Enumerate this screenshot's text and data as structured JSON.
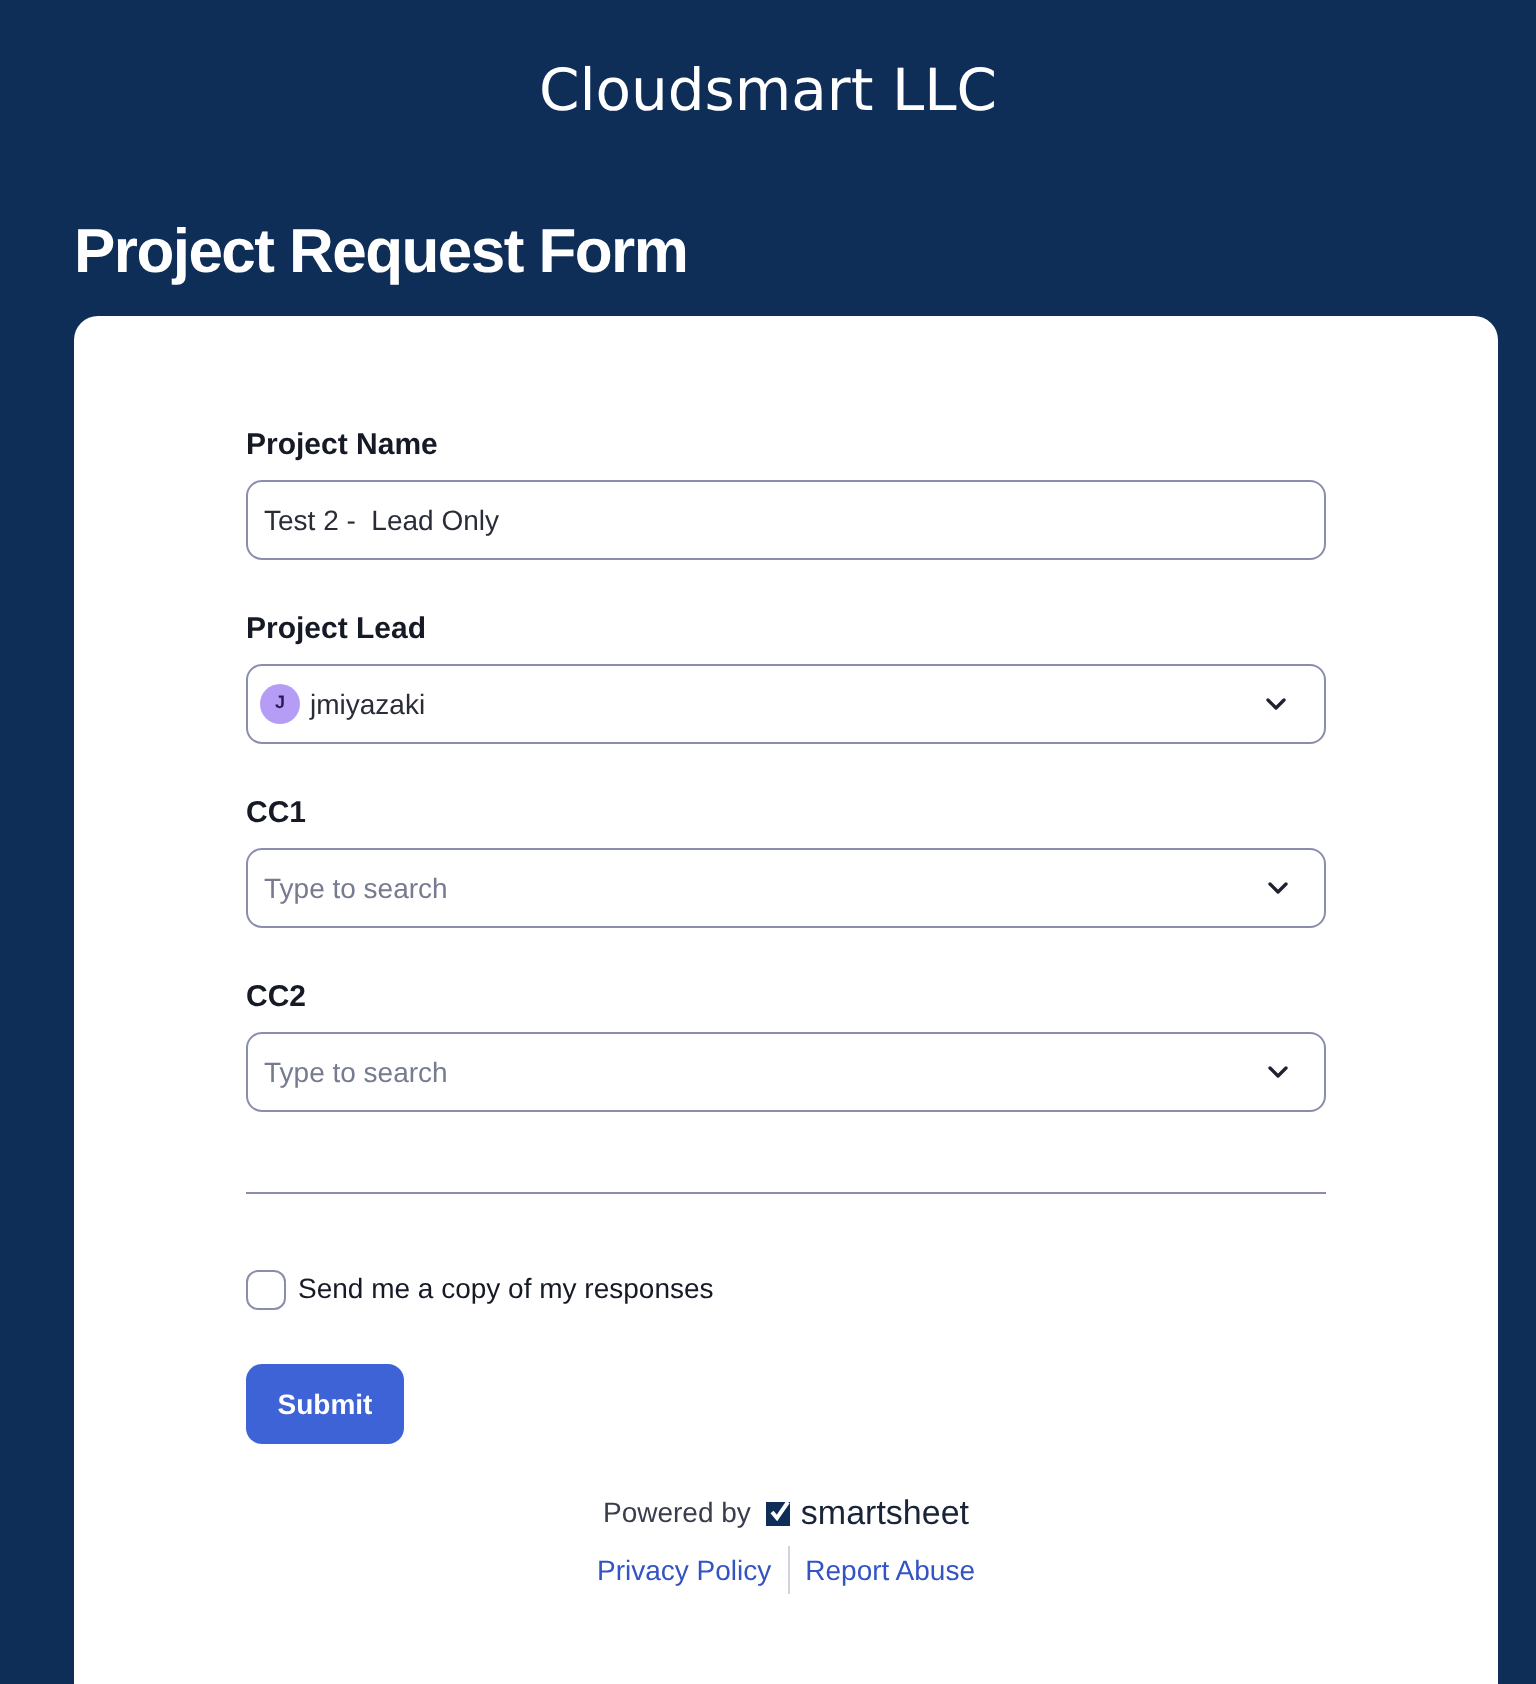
{
  "company": "Cloudsmart LLC",
  "title": "Project Request Form",
  "fields": [
    {
      "kind": "text",
      "label": "Project Name",
      "value": "Test 2 -  Lead Only"
    },
    {
      "kind": "person",
      "label": "Project Lead",
      "initial": "J",
      "value": "jmiyazaki"
    },
    {
      "kind": "select",
      "label": "CC1",
      "placeholder": "Type to search"
    },
    {
      "kind": "select",
      "label": "CC2",
      "placeholder": "Type to search"
    }
  ],
  "copy_option": {
    "label": "Send me a copy of my responses",
    "checked": false
  },
  "submit": "Submit",
  "footer": {
    "powered_by": "Powered by",
    "brand": "smartsheet",
    "links": [
      "Privacy Policy",
      "Report Abuse"
    ]
  }
}
